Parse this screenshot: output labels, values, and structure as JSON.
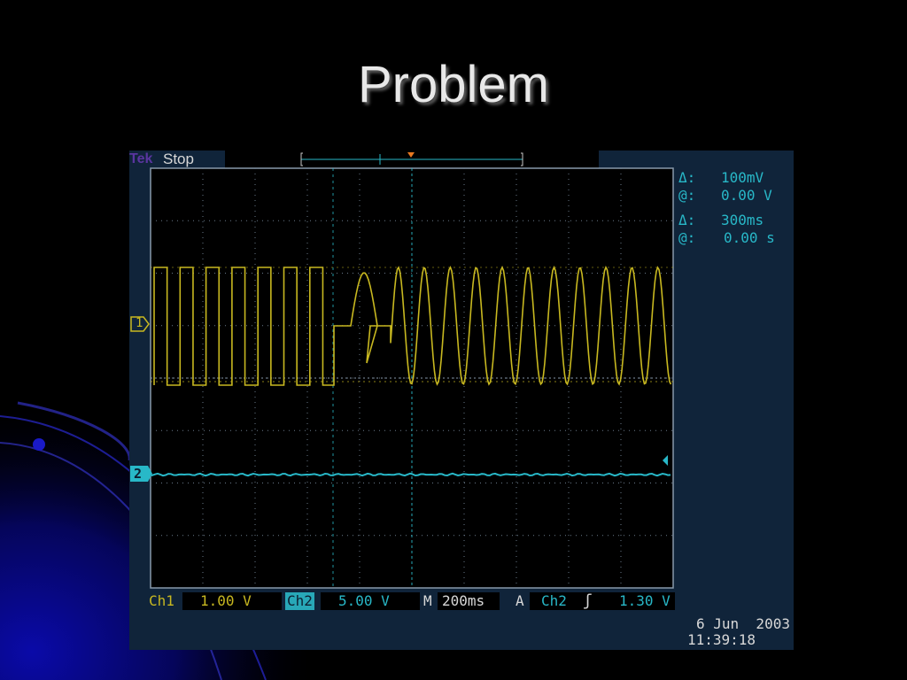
{
  "slide": {
    "title": "Problem"
  },
  "scope": {
    "logo": "Tek",
    "status": "Stop",
    "cursors": {
      "delta_v_symbol": "Δ:",
      "delta_v": "100mV",
      "at_v_symbol": "@:",
      "at_v": "0.00 V",
      "delta_t_symbol": "Δ:",
      "delta_t": "300ms",
      "at_t_symbol": "@:",
      "at_t": "0.00 s"
    },
    "ch1_marker": "1",
    "ch2_marker": "2",
    "bottom": {
      "ch1_label": "Ch1",
      "ch1_scale": "1.00 V",
      "ch2_label": "Ch2",
      "ch2_scale": "5.00 V",
      "time_label": "M",
      "time_scale": "200ms",
      "trigger_label": "A",
      "trigger_source": "Ch2",
      "trigger_level": "1.30 V"
    },
    "date": "6 Jun  2003",
    "time": "11:39:18",
    "colors": {
      "ch1": "#c8b820",
      "ch2": "#28b8c8",
      "grid": "#6a7a8a",
      "background": "#10243a"
    }
  }
}
